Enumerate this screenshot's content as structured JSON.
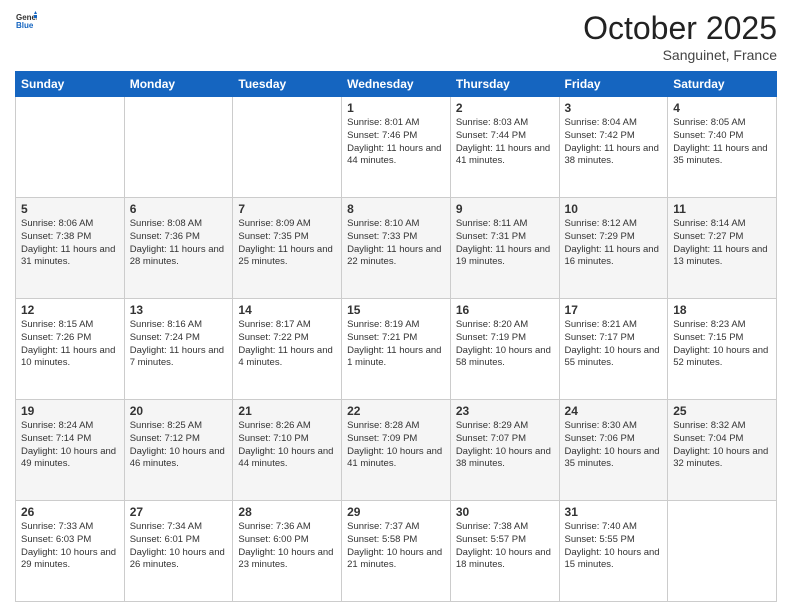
{
  "header": {
    "logo_general": "General",
    "logo_blue": "Blue",
    "month_title": "October 2025",
    "location": "Sanguinet, France"
  },
  "days_of_week": [
    "Sunday",
    "Monday",
    "Tuesday",
    "Wednesday",
    "Thursday",
    "Friday",
    "Saturday"
  ],
  "weeks": [
    [
      {
        "day": "",
        "sunrise": "",
        "sunset": "",
        "daylight": ""
      },
      {
        "day": "",
        "sunrise": "",
        "sunset": "",
        "daylight": ""
      },
      {
        "day": "",
        "sunrise": "",
        "sunset": "",
        "daylight": ""
      },
      {
        "day": "1",
        "sunrise": "Sunrise: 8:01 AM",
        "sunset": "Sunset: 7:46 PM",
        "daylight": "Daylight: 11 hours and 44 minutes."
      },
      {
        "day": "2",
        "sunrise": "Sunrise: 8:03 AM",
        "sunset": "Sunset: 7:44 PM",
        "daylight": "Daylight: 11 hours and 41 minutes."
      },
      {
        "day": "3",
        "sunrise": "Sunrise: 8:04 AM",
        "sunset": "Sunset: 7:42 PM",
        "daylight": "Daylight: 11 hours and 38 minutes."
      },
      {
        "day": "4",
        "sunrise": "Sunrise: 8:05 AM",
        "sunset": "Sunset: 7:40 PM",
        "daylight": "Daylight: 11 hours and 35 minutes."
      }
    ],
    [
      {
        "day": "5",
        "sunrise": "Sunrise: 8:06 AM",
        "sunset": "Sunset: 7:38 PM",
        "daylight": "Daylight: 11 hours and 31 minutes."
      },
      {
        "day": "6",
        "sunrise": "Sunrise: 8:08 AM",
        "sunset": "Sunset: 7:36 PM",
        "daylight": "Daylight: 11 hours and 28 minutes."
      },
      {
        "day": "7",
        "sunrise": "Sunrise: 8:09 AM",
        "sunset": "Sunset: 7:35 PM",
        "daylight": "Daylight: 11 hours and 25 minutes."
      },
      {
        "day": "8",
        "sunrise": "Sunrise: 8:10 AM",
        "sunset": "Sunset: 7:33 PM",
        "daylight": "Daylight: 11 hours and 22 minutes."
      },
      {
        "day": "9",
        "sunrise": "Sunrise: 8:11 AM",
        "sunset": "Sunset: 7:31 PM",
        "daylight": "Daylight: 11 hours and 19 minutes."
      },
      {
        "day": "10",
        "sunrise": "Sunrise: 8:12 AM",
        "sunset": "Sunset: 7:29 PM",
        "daylight": "Daylight: 11 hours and 16 minutes."
      },
      {
        "day": "11",
        "sunrise": "Sunrise: 8:14 AM",
        "sunset": "Sunset: 7:27 PM",
        "daylight": "Daylight: 11 hours and 13 minutes."
      }
    ],
    [
      {
        "day": "12",
        "sunrise": "Sunrise: 8:15 AM",
        "sunset": "Sunset: 7:26 PM",
        "daylight": "Daylight: 11 hours and 10 minutes."
      },
      {
        "day": "13",
        "sunrise": "Sunrise: 8:16 AM",
        "sunset": "Sunset: 7:24 PM",
        "daylight": "Daylight: 11 hours and 7 minutes."
      },
      {
        "day": "14",
        "sunrise": "Sunrise: 8:17 AM",
        "sunset": "Sunset: 7:22 PM",
        "daylight": "Daylight: 11 hours and 4 minutes."
      },
      {
        "day": "15",
        "sunrise": "Sunrise: 8:19 AM",
        "sunset": "Sunset: 7:21 PM",
        "daylight": "Daylight: 11 hours and 1 minute."
      },
      {
        "day": "16",
        "sunrise": "Sunrise: 8:20 AM",
        "sunset": "Sunset: 7:19 PM",
        "daylight": "Daylight: 10 hours and 58 minutes."
      },
      {
        "day": "17",
        "sunrise": "Sunrise: 8:21 AM",
        "sunset": "Sunset: 7:17 PM",
        "daylight": "Daylight: 10 hours and 55 minutes."
      },
      {
        "day": "18",
        "sunrise": "Sunrise: 8:23 AM",
        "sunset": "Sunset: 7:15 PM",
        "daylight": "Daylight: 10 hours and 52 minutes."
      }
    ],
    [
      {
        "day": "19",
        "sunrise": "Sunrise: 8:24 AM",
        "sunset": "Sunset: 7:14 PM",
        "daylight": "Daylight: 10 hours and 49 minutes."
      },
      {
        "day": "20",
        "sunrise": "Sunrise: 8:25 AM",
        "sunset": "Sunset: 7:12 PM",
        "daylight": "Daylight: 10 hours and 46 minutes."
      },
      {
        "day": "21",
        "sunrise": "Sunrise: 8:26 AM",
        "sunset": "Sunset: 7:10 PM",
        "daylight": "Daylight: 10 hours and 44 minutes."
      },
      {
        "day": "22",
        "sunrise": "Sunrise: 8:28 AM",
        "sunset": "Sunset: 7:09 PM",
        "daylight": "Daylight: 10 hours and 41 minutes."
      },
      {
        "day": "23",
        "sunrise": "Sunrise: 8:29 AM",
        "sunset": "Sunset: 7:07 PM",
        "daylight": "Daylight: 10 hours and 38 minutes."
      },
      {
        "day": "24",
        "sunrise": "Sunrise: 8:30 AM",
        "sunset": "Sunset: 7:06 PM",
        "daylight": "Daylight: 10 hours and 35 minutes."
      },
      {
        "day": "25",
        "sunrise": "Sunrise: 8:32 AM",
        "sunset": "Sunset: 7:04 PM",
        "daylight": "Daylight: 10 hours and 32 minutes."
      }
    ],
    [
      {
        "day": "26",
        "sunrise": "Sunrise: 7:33 AM",
        "sunset": "Sunset: 6:03 PM",
        "daylight": "Daylight: 10 hours and 29 minutes."
      },
      {
        "day": "27",
        "sunrise": "Sunrise: 7:34 AM",
        "sunset": "Sunset: 6:01 PM",
        "daylight": "Daylight: 10 hours and 26 minutes."
      },
      {
        "day": "28",
        "sunrise": "Sunrise: 7:36 AM",
        "sunset": "Sunset: 6:00 PM",
        "daylight": "Daylight: 10 hours and 23 minutes."
      },
      {
        "day": "29",
        "sunrise": "Sunrise: 7:37 AM",
        "sunset": "Sunset: 5:58 PM",
        "daylight": "Daylight: 10 hours and 21 minutes."
      },
      {
        "day": "30",
        "sunrise": "Sunrise: 7:38 AM",
        "sunset": "Sunset: 5:57 PM",
        "daylight": "Daylight: 10 hours and 18 minutes."
      },
      {
        "day": "31",
        "sunrise": "Sunrise: 7:40 AM",
        "sunset": "Sunset: 5:55 PM",
        "daylight": "Daylight: 10 hours and 15 minutes."
      },
      {
        "day": "",
        "sunrise": "",
        "sunset": "",
        "daylight": ""
      }
    ]
  ]
}
